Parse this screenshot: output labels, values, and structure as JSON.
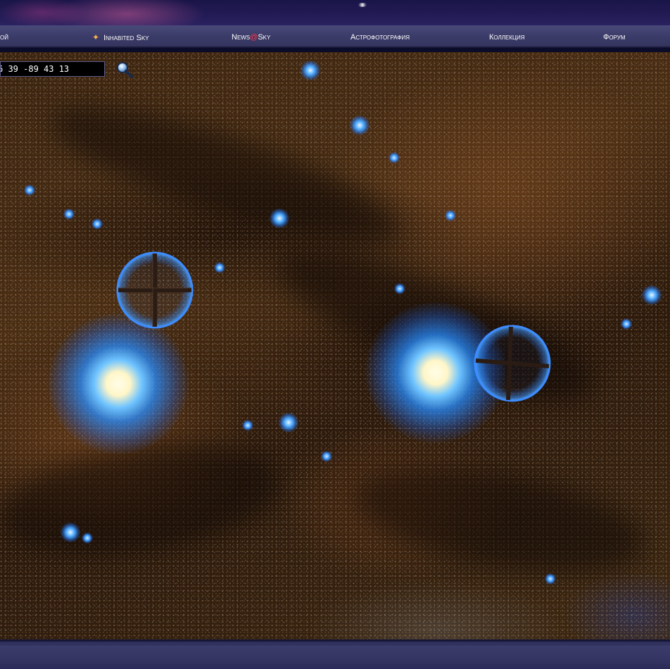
{
  "nav": {
    "items": [
      {
        "id": "prev",
        "label": "ой"
      },
      {
        "id": "inhabited-sky",
        "label": "Inhabited Sky",
        "icon": "star-icon"
      },
      {
        "id": "news-sky",
        "label_part1": "News",
        "label_part2": "@",
        "label_part3": "Sky"
      },
      {
        "id": "astrophoto",
        "label": "Астрофотография"
      },
      {
        "id": "collection",
        "label": "Коллекция"
      },
      {
        "id": "forum",
        "label": "Форум"
      }
    ]
  },
  "search": {
    "value": "6 39 -89 43 13",
    "icon": "magnifier-icon"
  },
  "colors": {
    "nav_background": "#3c3c6a",
    "nav_accent": "#ff3344",
    "star_blue": "#3a98ff"
  }
}
